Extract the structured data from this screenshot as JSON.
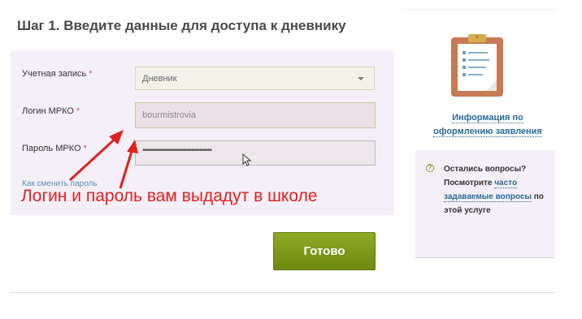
{
  "step_title": "Шаг 1. Введите данные для доступа к дневнику",
  "form": {
    "account_label": "Учетная запись",
    "account_value": "Дневник",
    "login_label": "Логин МРКО",
    "login_value": "bourmistrovia",
    "password_label": "Пароль МРКО",
    "password_value": "••••••••••••••••••••••••••••••••••",
    "required_mark": "*",
    "change_password_link": "Как сменить пароль"
  },
  "annotation": "Логин и пароль вам выдадут в школе",
  "submit_label": "Готово",
  "sidebar": {
    "info_line1": "Информация по",
    "info_line2": "оформлению заявления",
    "help_icon_glyph": "?",
    "help_pre": "Остались вопросы? Посмотрите ",
    "help_link": "часто задаваемые вопросы",
    "help_post": " по этой услуге"
  },
  "colors": {
    "accent_green": "#7a9618",
    "link_blue": "#2a6a9a",
    "annotation_red": "#e0211c",
    "panel_bg": "#f4eff8"
  }
}
